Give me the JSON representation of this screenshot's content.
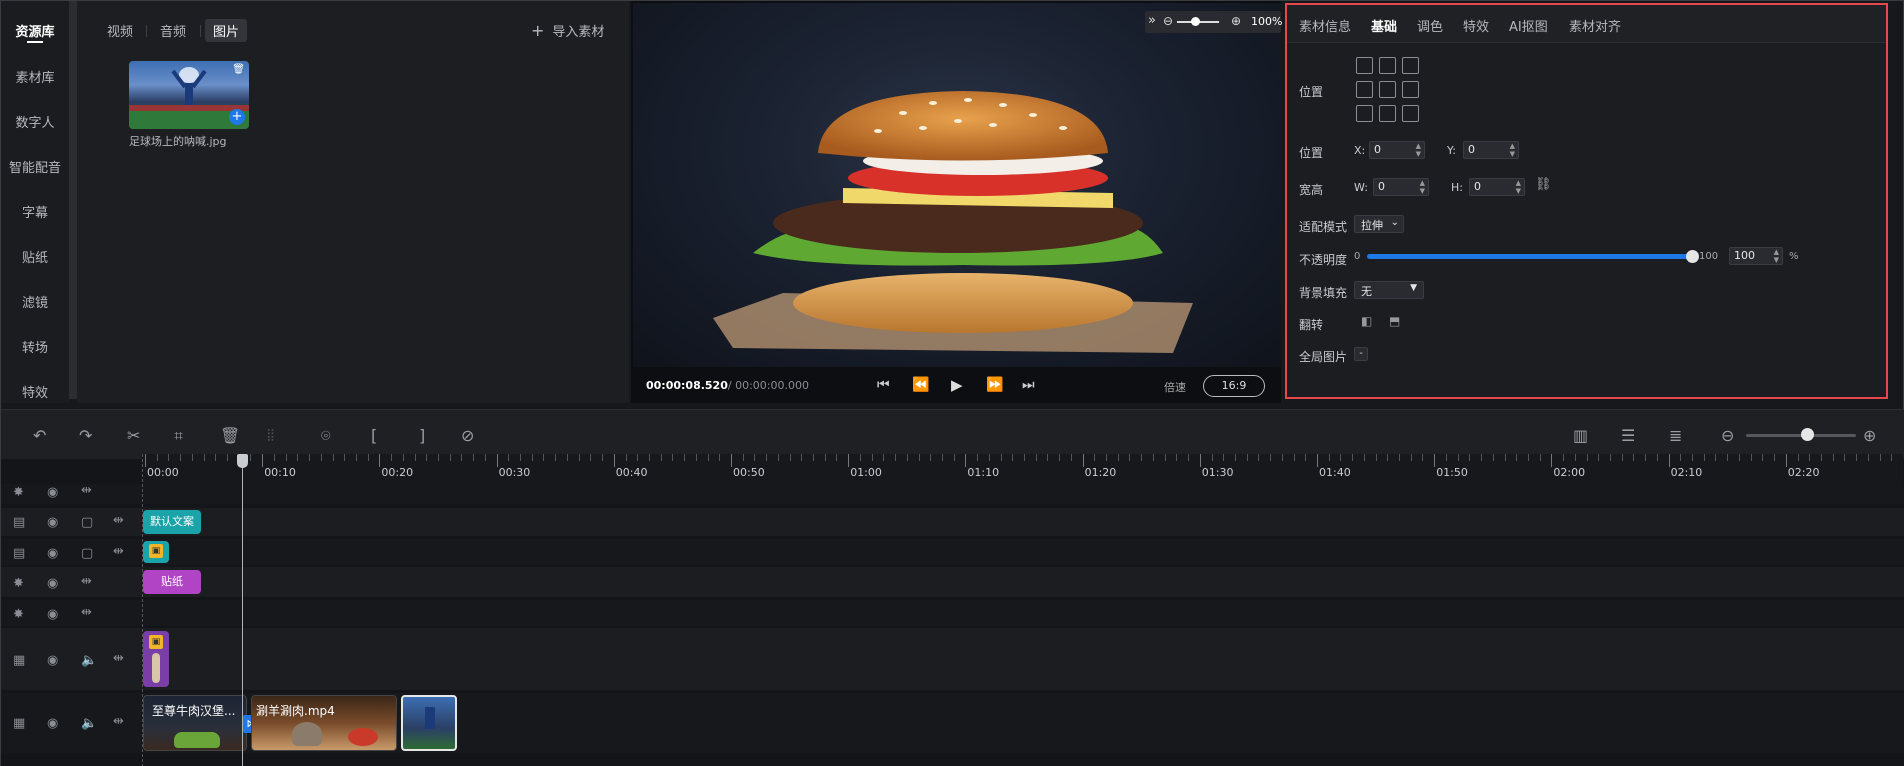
{
  "leftnav": {
    "items": [
      {
        "label": "资源库",
        "active": true
      },
      {
        "label": "素材库"
      },
      {
        "label": "数字人"
      },
      {
        "label": "智能配音"
      },
      {
        "label": "字幕"
      },
      {
        "label": "贴纸"
      },
      {
        "label": "滤镜"
      },
      {
        "label": "转场"
      },
      {
        "label": "特效"
      }
    ]
  },
  "library": {
    "tabs": [
      {
        "label": "视频"
      },
      {
        "label": "音频"
      },
      {
        "label": "图片",
        "active": true
      }
    ],
    "import_label": "导入素材",
    "assets": [
      {
        "name": "足球场上的呐喊.jpg"
      }
    ]
  },
  "preview": {
    "zoom": "100%",
    "time_current": "00:00:08.520",
    "time_total": "/ 00:00:00.000",
    "speed_label": "倍速",
    "aspect": "16:9"
  },
  "props": {
    "tabs": [
      {
        "label": "素材信息"
      },
      {
        "label": "基础",
        "active": true
      },
      {
        "label": "调色"
      },
      {
        "label": "特效"
      },
      {
        "label": "AI抠图"
      },
      {
        "label": "素材对齐"
      }
    ],
    "position_grid_label": "位置",
    "position_label": "位置",
    "x_label": "X:",
    "x_value": "0",
    "y_label": "Y:",
    "y_value": "0",
    "size_label": "宽高",
    "w_label": "W:",
    "w_value": "0",
    "h_label": "H:",
    "h_value": "0",
    "fit_label": "适配模式",
    "fit_value": "拉伸",
    "opacity_label": "不透明度",
    "opacity_min": "0",
    "opacity_max": "100",
    "opacity_value": "100",
    "opacity_unit": "%",
    "opacity_level": 1.0,
    "bg_label": "背景填充",
    "bg_value": "无",
    "flip_label": "翻转",
    "global_label": "全局图片",
    "global_value": "-"
  },
  "timeline": {
    "ticks": [
      "00:00",
      "00:10",
      "00:20",
      "00:30",
      "00:40",
      "00:50",
      "01:00",
      "01:10",
      "01:20",
      "01:30",
      "01:40",
      "01:50",
      "02:00",
      "02:10",
      "02:20"
    ],
    "clips": {
      "text": "默认文案",
      "sticker": "贴纸",
      "video1": "至尊牛肉汉堡...",
      "video2": "涮羊涮肉.mp4"
    }
  },
  "colors": {
    "accent": "#1e78e6",
    "highlight": "#e5484d",
    "text_clip": "#1aa3a8",
    "sticker_clip": "#b044c4",
    "portrait_clip": "#7a3fa6"
  }
}
